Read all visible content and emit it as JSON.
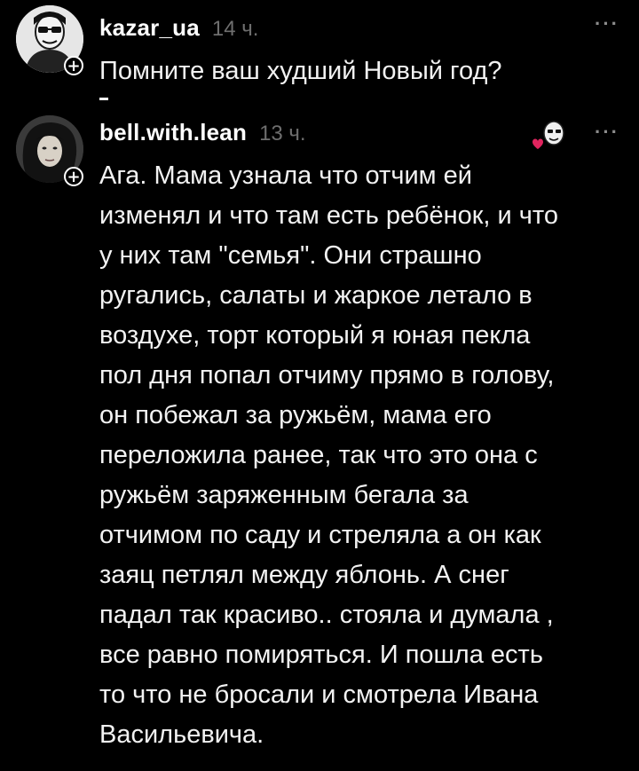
{
  "posts": [
    {
      "username": "kazar_ua",
      "timestamp": "14 ч.",
      "more": "···",
      "body_lines": [
        "Помните ваш худший Новый год?"
      ]
    },
    {
      "username": "bell.with.lean",
      "timestamp": "13 ч.",
      "more": "···",
      "body_lines": [
        "Ага. Мама узнала что отчим ей",
        "изменял и что там есть ребёнок, и что",
        "у них там \"семья\". Они страшно",
        "ругались, салаты и жаркое летало в",
        "воздухе, торт который я юная пекла",
        "пол дня попал отчиму прямо в голову,",
        "он побежал за ружьём, мама его",
        "переложила ранее, так что это она с",
        "ружьём заряженным бегала за",
        "отчимом по саду и стреляла а он как",
        "заяц петлял между яблонь. А снег",
        "падал так красиво.. стояла и думала ,",
        "все равно помиряться. И пошла есть",
        "то что не бросали и смотрела Ивана",
        "Васильевича."
      ]
    }
  ],
  "icons": {
    "plus": "+",
    "reaction": "heart-face-icon"
  },
  "colors": {
    "background": "#000000",
    "text": "#f2f2f2",
    "muted": "#6e6e6e",
    "accent_heart": "#e0245e"
  }
}
